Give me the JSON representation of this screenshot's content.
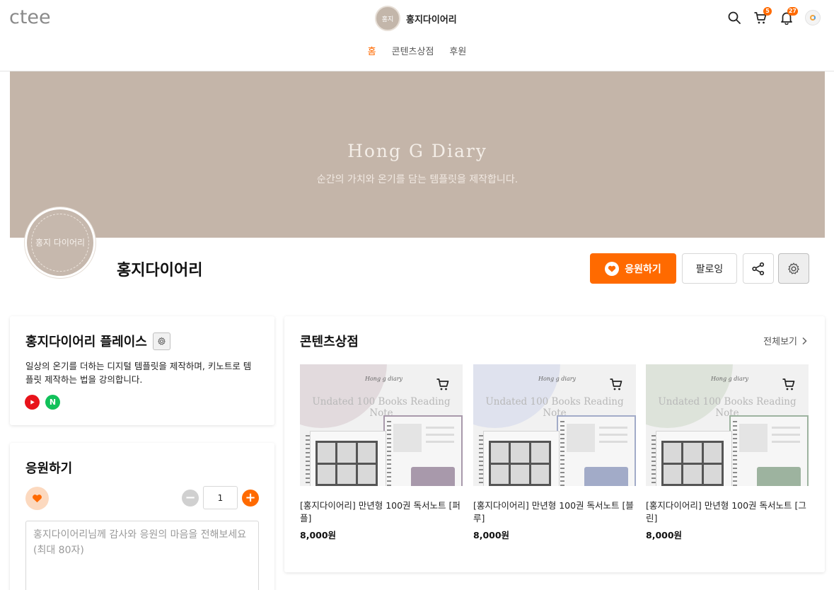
{
  "header": {
    "logo": "ctee",
    "brand_name": "홍지다이어리",
    "brand_avatar_text": "홍지",
    "cart_count": "5",
    "notification_count": "27"
  },
  "nav": {
    "items": [
      {
        "label": "홈",
        "active": true
      },
      {
        "label": "콘텐츠상점",
        "active": false
      },
      {
        "label": "후원",
        "active": false
      }
    ]
  },
  "banner": {
    "title": "Hong G Diary",
    "subtitle": "순간의 가치와 온기를 담는 템플릿을 제작합니다.",
    "color": "#c4b5a9"
  },
  "profile": {
    "avatar_text": "홍지 다이어리",
    "name": "홍지다이어리",
    "support_label": "응원하기",
    "follow_label": "팔로잉"
  },
  "place": {
    "title": "홍지다이어리 플레이스",
    "description": "일상의 온기를 더하는 디지털 템플릿을 제작하며, 키노트로 템플릿 제작하는 법을 강의합니다.",
    "socials": [
      "youtube-icon",
      "naver-icon"
    ]
  },
  "support": {
    "title": "응원하기",
    "quantity": "1",
    "message_placeholder": "홍지다이어리님께 감사와 응원의 마음을 전해보세요 (최대 80자)"
  },
  "store": {
    "title": "콘텐츠상점",
    "see_all": "전체보기",
    "products": [
      {
        "thumb_script": "Hong g diary",
        "thumb_title": "Undated 100 Books Reading Note",
        "name": "[홍지다이어리] 만년형 100권 독서노트 [퍼플]",
        "price": "8,000원",
        "accent": "#a899ab",
        "arc": "#e2dadd"
      },
      {
        "thumb_script": "Hong g diary",
        "thumb_title": "Undated 100 Books Reading Note",
        "name": "[홍지다이어리] 만년형 100권 독서노트 [블루]",
        "price": "8,000원",
        "accent": "#a2abc8",
        "arc": "#dfe2ee"
      },
      {
        "thumb_script": "Hong g diary",
        "thumb_title": "Undated 100 Books Reading Note",
        "name": "[홍지다이어리] 만년형 100권 독서노트 [그린]",
        "price": "8,000원",
        "accent": "#9db39f",
        "arc": "#dde3da"
      }
    ]
  },
  "colors": {
    "accent": "#ff6a00"
  }
}
